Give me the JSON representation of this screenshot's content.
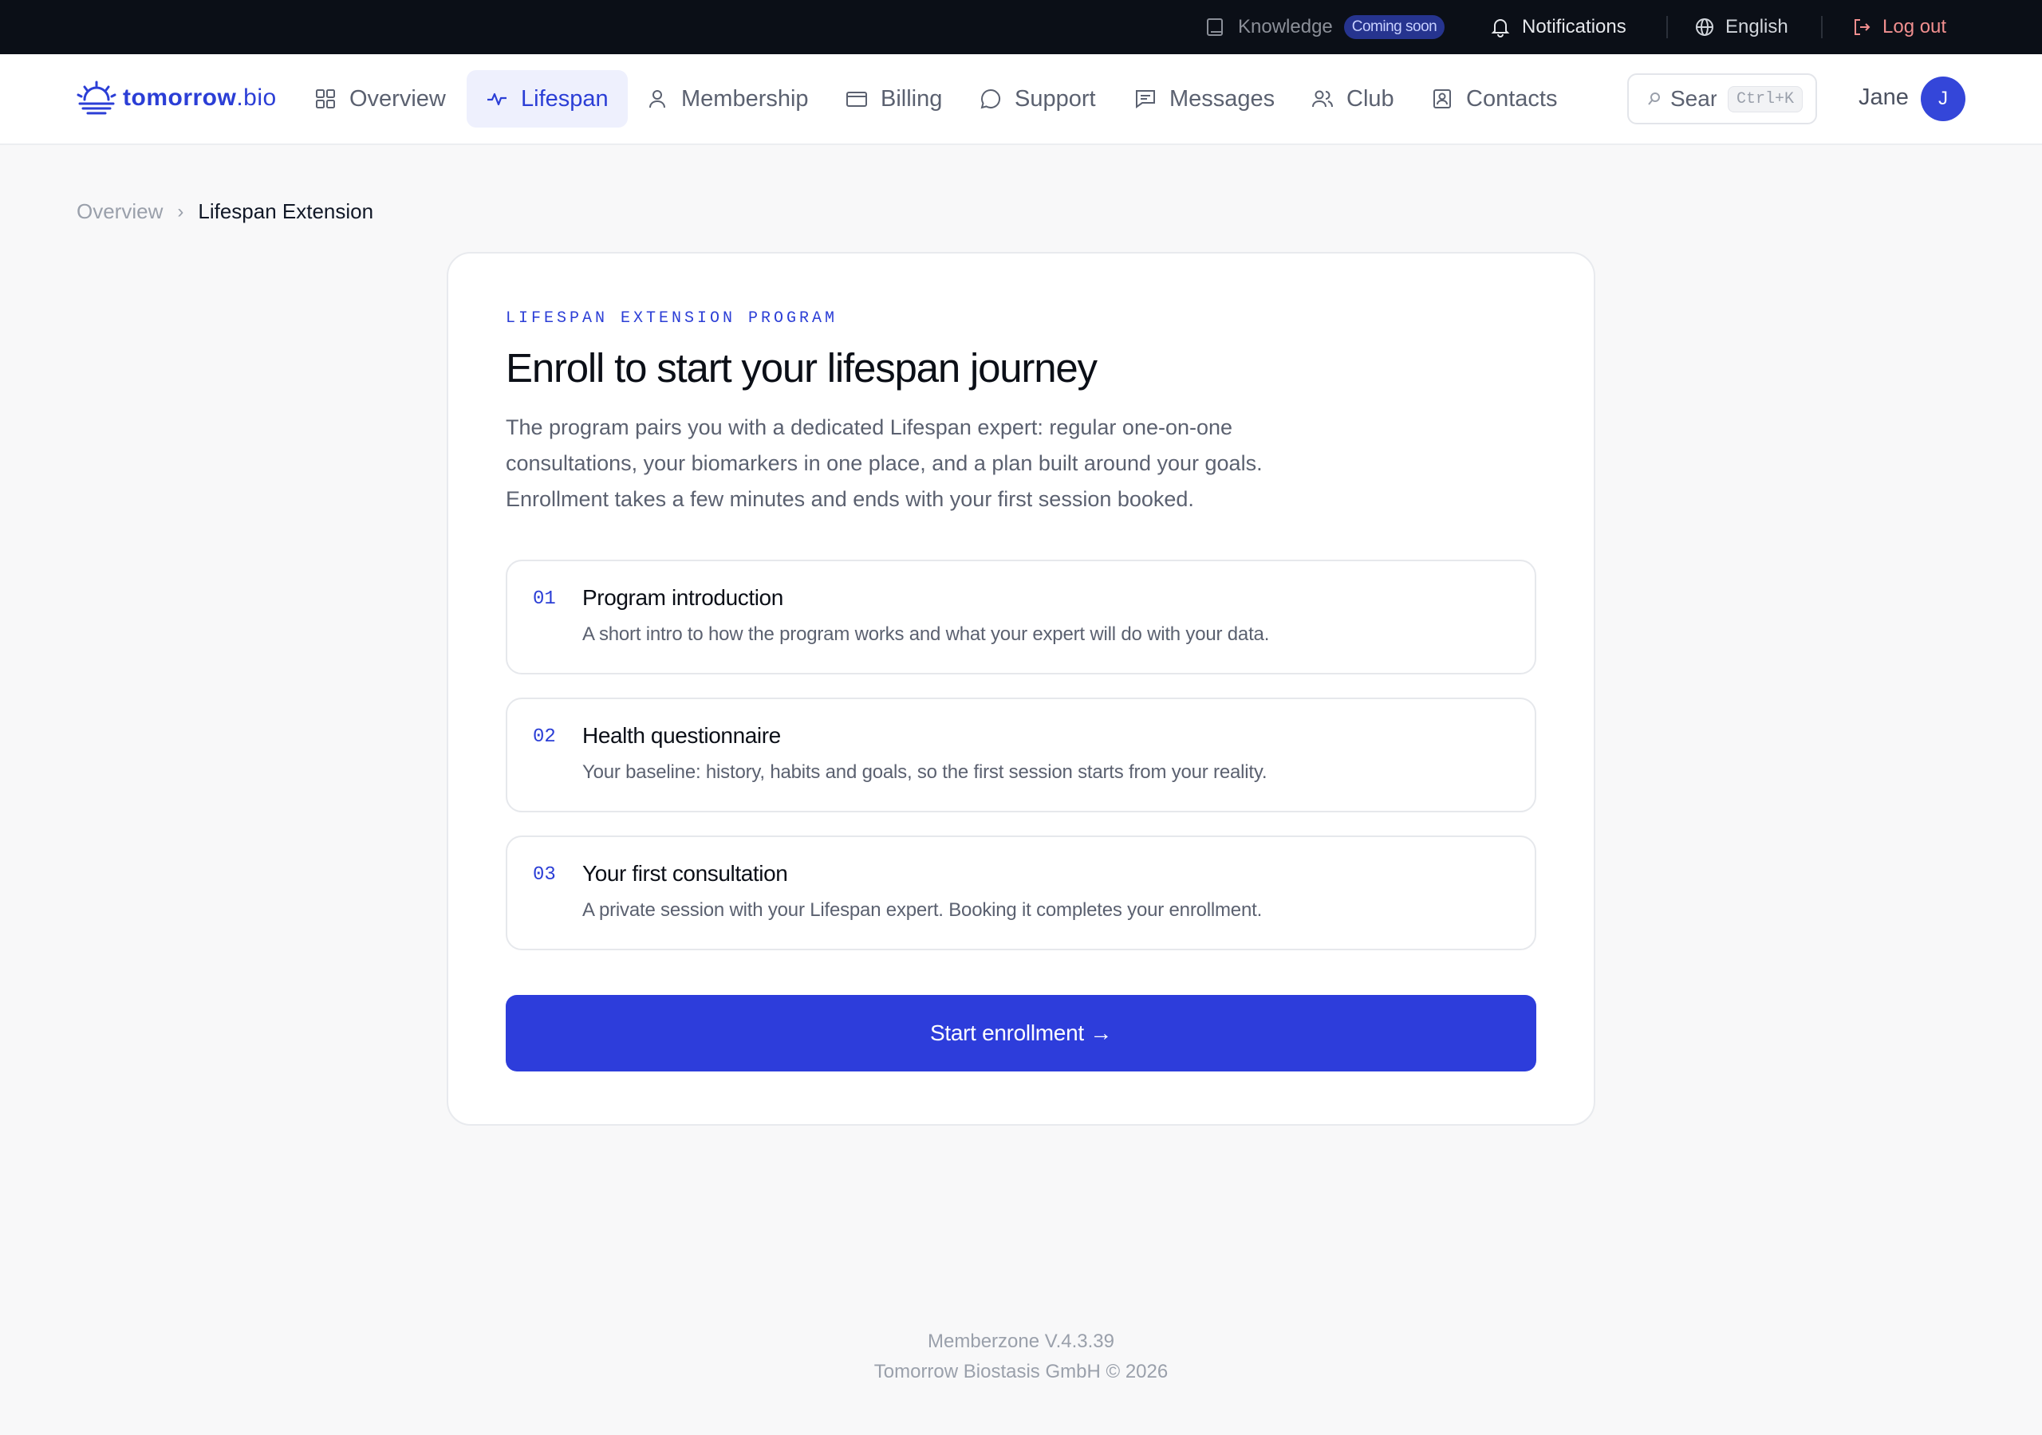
{
  "topbar": {
    "knowledge_label": "Knowledge",
    "knowledge_badge": "Coming soon",
    "notifications_label": "Notifications",
    "language_label": "English",
    "logout_label": "Log out"
  },
  "brand": {
    "name_bold": "tomorrow",
    "name_light": ".bio",
    "color": "#2b3ed6"
  },
  "nav": {
    "items": [
      {
        "label": "Overview",
        "icon": "grid-icon"
      },
      {
        "label": "Lifespan",
        "icon": "pulse-icon",
        "active": true
      },
      {
        "label": "Membership",
        "icon": "user-icon"
      },
      {
        "label": "Billing",
        "icon": "card-icon"
      },
      {
        "label": "Support",
        "icon": "chat-bubble-icon"
      },
      {
        "label": "Messages",
        "icon": "message-icon"
      },
      {
        "label": "Club",
        "icon": "users-icon"
      },
      {
        "label": "Contacts",
        "icon": "contact-card-icon"
      }
    ]
  },
  "search": {
    "placeholder": "Sear",
    "shortcut": "Ctrl+K"
  },
  "user": {
    "name": "Jane",
    "initial": "J"
  },
  "breadcrumb": {
    "parent": "Overview",
    "separator": "›",
    "current": "Lifespan Extension"
  },
  "card": {
    "eyebrow": "LIFESPAN EXTENSION PROGRAM",
    "title": "Enroll to start your lifespan journey",
    "intro_lines": [
      "The program pairs you with a dedicated Lifespan expert: regular one-on-one",
      "consultations, your biomarkers in one place, and a plan built around your goals.",
      "Enrollment takes a few minutes and ends with your first session booked."
    ],
    "steps": [
      {
        "number": "01",
        "title": "Program introduction",
        "description": "A short intro to how the program works and what your expert will do with your data."
      },
      {
        "number": "02",
        "title": "Health questionnaire",
        "description": "Your baseline: history, habits and goals, so the first session starts from your reality."
      },
      {
        "number": "03",
        "title": "Your first consultation",
        "description": "A private session with your Lifespan expert. Booking it completes your enrollment."
      }
    ],
    "cta_label": "Start enrollment →"
  },
  "footer": {
    "version": "Memberzone V.4.3.39",
    "copyright": "Tomorrow Biostasis GmbH © 2026"
  },
  "colors": {
    "accent": "#2d3ddb",
    "topbar_bg": "#0b0f17",
    "logout": "#f18f8f",
    "page_bg": "#f8f8f9"
  }
}
